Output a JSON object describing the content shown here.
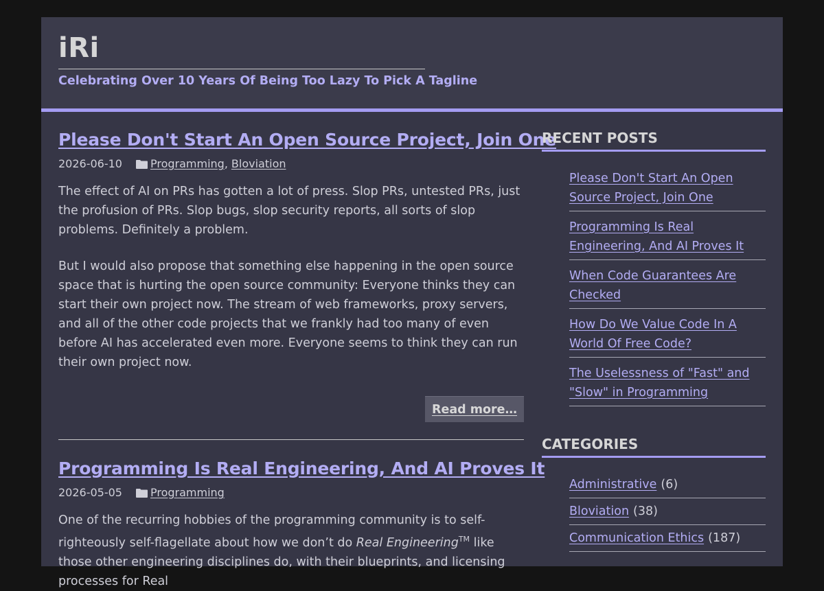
{
  "site": {
    "title": "iRi",
    "tagline": "Celebrating Over 10 Years Of Being Too Lazy To Pick A Tagline"
  },
  "posts": [
    {
      "title": "Please Don't Start An Open Source Project, Join One",
      "date": "2026-06-10",
      "categories": [
        "Programming",
        "Bloviation"
      ],
      "category_separator": ",",
      "paragraphs": [
        "The effect of AI on PRs has gotten a lot of press. Slop PRs, untested PRs, just the profusion of PRs. Slop bugs, slop security reports, all sorts of slop problems. Definitely a problem.",
        "But I would also propose that something else happening in the open source space that is hurting the open source community: Everyone thinks they can start their own project now. The stream of web frameworks, proxy servers, and all of the other code projects that we frankly had too many of even before AI has accelerated even more. Everyone seems to think they can run their own project now."
      ],
      "read_more": "Read more…"
    },
    {
      "title": "Programming Is Real Engineering, And AI Proves It",
      "date": "2026-05-05",
      "categories": [
        "Programming"
      ],
      "para_before": "One of the recurring hobbies of the programming community is to self-righteously self-flagellate about how we don’t do ",
      "para_em": "Real Engineering",
      "para_sup": "TM",
      "para_after": " like those other engineering disciplines do, with their blueprints, and licensing processes for Real"
    }
  ],
  "sidebar": {
    "recent_heading": "RECENT POSTS",
    "recent": [
      "Please Don't Start An Open Source Project, Join One",
      "Programming Is Real Engineering, And AI Proves It",
      "When Code Guarantees Are Checked",
      "How Do We Value Code In A World Of Free Code?",
      "The Uselessness of \"Fast\" and \"Slow\" in Programming"
    ],
    "categories_heading": "CATEGORIES",
    "categories": [
      {
        "name": "Administrative",
        "count": "(6)"
      },
      {
        "name": "Bloviation",
        "count": "(38)"
      },
      {
        "name": "Communication Ethics",
        "count": "(187)"
      }
    ]
  },
  "colors": {
    "accent": "#a49cf2",
    "link": "#b3adf4",
    "page_bg": "#141414",
    "content_bg": "#363646",
    "header_bg": "#3b3b4b"
  },
  "icons": {
    "category": "folder-icon"
  }
}
